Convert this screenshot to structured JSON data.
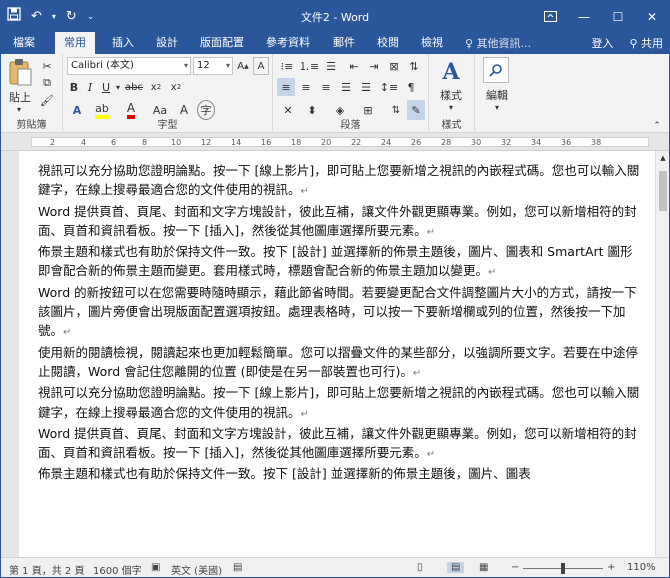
{
  "window": {
    "title": "文件2 - Word"
  },
  "tabs": [
    "檔案",
    "常用",
    "插入",
    "設計",
    "版面配置",
    "參考資料",
    "郵件",
    "校閱",
    "檢視"
  ],
  "tell_me": "其他資訊...",
  "sign_in": "登入",
  "share": "共用",
  "ribbon": {
    "paste": "貼上",
    "font_name": "Calibri (本文)",
    "font_size": "12",
    "style_btn": "樣式",
    "edit_btn": "編輯",
    "groups": {
      "clipboard": "剪貼簿",
      "font": "字型",
      "paragraph": "段落",
      "styles": "樣式"
    }
  },
  "ruler_numbers": [
    "2",
    "4",
    "6",
    "8",
    "10",
    "12",
    "14",
    "16",
    "18",
    "20",
    "22",
    "24",
    "26",
    "28",
    "30",
    "32",
    "34",
    "36",
    "38"
  ],
  "document": {
    "paragraphs": [
      {
        "text": "視訊可以充分協助您證明論點。按一下 [線上影片]，即可貼上您要新增之視訊的內嵌程式碼。您也可以輸入關鍵字，在線上搜尋最適合您的文件使用的視訊。"
      },
      {
        "text": "Word 提供頁首、頁尾、封面和文字方塊設計，彼此互補，讓文件外觀更顯專業。例如，您可以新增相符的封面、頁首和資訊看板。按一下 [插入]，然後從其他圖庫選擇所要元素。"
      },
      {
        "text": "佈景主題和樣式也有助於保持文件一致。按下 [設計] 並選擇新的佈景主題後，圖片、圖表和 SmartArt 圖形即會配合新的佈景主題而變更。套用樣式時，標題會配合新的佈景主題加以變更。"
      },
      {
        "text": "Word 的新按鈕可以在您需要時隨時顯示，藉此節省時間。若要變更配合文件調整圖片大小的方式，請按一下該圖片，圖片旁便會出現版面配置選項按鈕。處理表格時，可以按一下要新增欄或列的位置，然後按一下加號。"
      },
      {
        "text": "使用新的閱讀檢視，閱讀起來也更加輕鬆簡單。您可以摺疊文件的某些部分，以強調所要文字。若要在中途停止閱讀，Word 會記住您離開的位置 (即使是在另一部裝置也可行)。"
      },
      {
        "text": "視訊可以充分協助您證明論點。按一下 [線上影片]，即可貼上您要新增之視訊的內嵌程式碼。您也可以輸入關鍵字，在線上搜尋最適合您的文件使用的視訊。"
      },
      {
        "text": "Word 提供頁首、頁尾、封面和文字方塊設計，彼此互補，讓文件外觀更顯專業。例如，您可以新增相符的封面、頁首和資訊看板。按一下 [插入]，然後從其他圖庫選擇所要元素。"
      },
      {
        "text": "佈景主題和樣式也有助於保持文件一致。按下 [設計] 並選擇新的佈景主題後，圖片、圖表"
      }
    ],
    "paragraph_mark": "↵"
  },
  "status": {
    "page": "第 1 頁，共 2 頁",
    "words": "1600 個字",
    "lang": "英文 (美國)",
    "zoom": "110%"
  },
  "colors": {
    "accent": "#2b579a",
    "ribbon": "#f3f3f3"
  }
}
